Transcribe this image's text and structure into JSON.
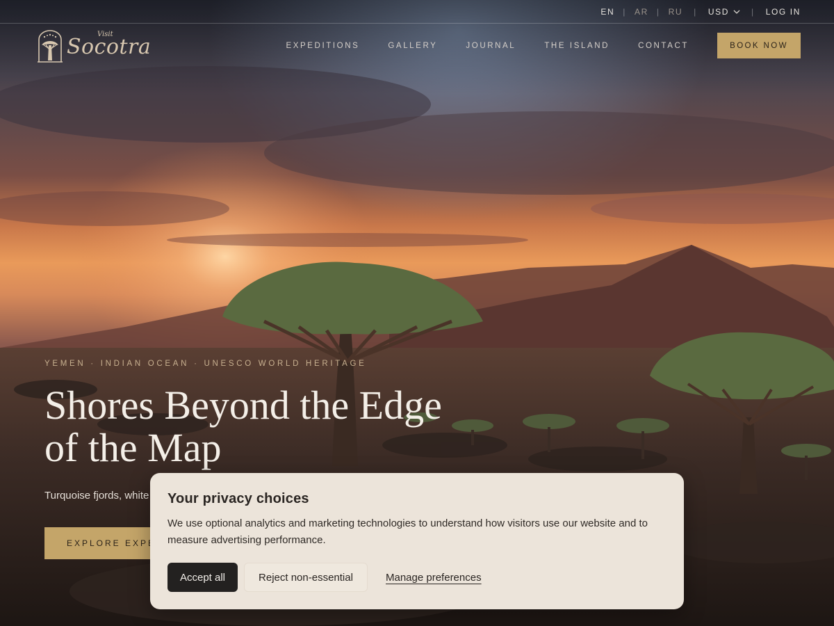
{
  "utility": {
    "languages": [
      "EN",
      "AR",
      "RU"
    ],
    "currency": "USD",
    "login": "LOG IN"
  },
  "logo": {
    "visit": "Visit",
    "word": "Socotra"
  },
  "nav": {
    "items": [
      "EXPEDITIONS",
      "GALLERY",
      "JOURNAL",
      "THE ISLAND",
      "CONTACT"
    ],
    "cta": "BOOK NOW"
  },
  "hero": {
    "eyebrow": "YEMEN · INDIAN OCEAN · UNESCO WORLD HERITAGE",
    "headline_line1": "Shores Beyond the Edge",
    "headline_line2": "of the Map",
    "subtext": "Turquoise fjords, white",
    "cta": "EXPLORE EXPED"
  },
  "cookie": {
    "title": "Your privacy choices",
    "body": "We use optional analytics and marketing technologies to understand how visitors use our website and to measure advertising performance.",
    "accept": "Accept all",
    "reject": "Reject non-essential",
    "manage": "Manage preferences"
  },
  "colors": {
    "accent_gold": "#c4a569",
    "cookie_bg": "#ece4da",
    "accept_bg": "#232120"
  },
  "icons": [
    "chevron-down-icon",
    "dragon-tree-logo-icon"
  ]
}
